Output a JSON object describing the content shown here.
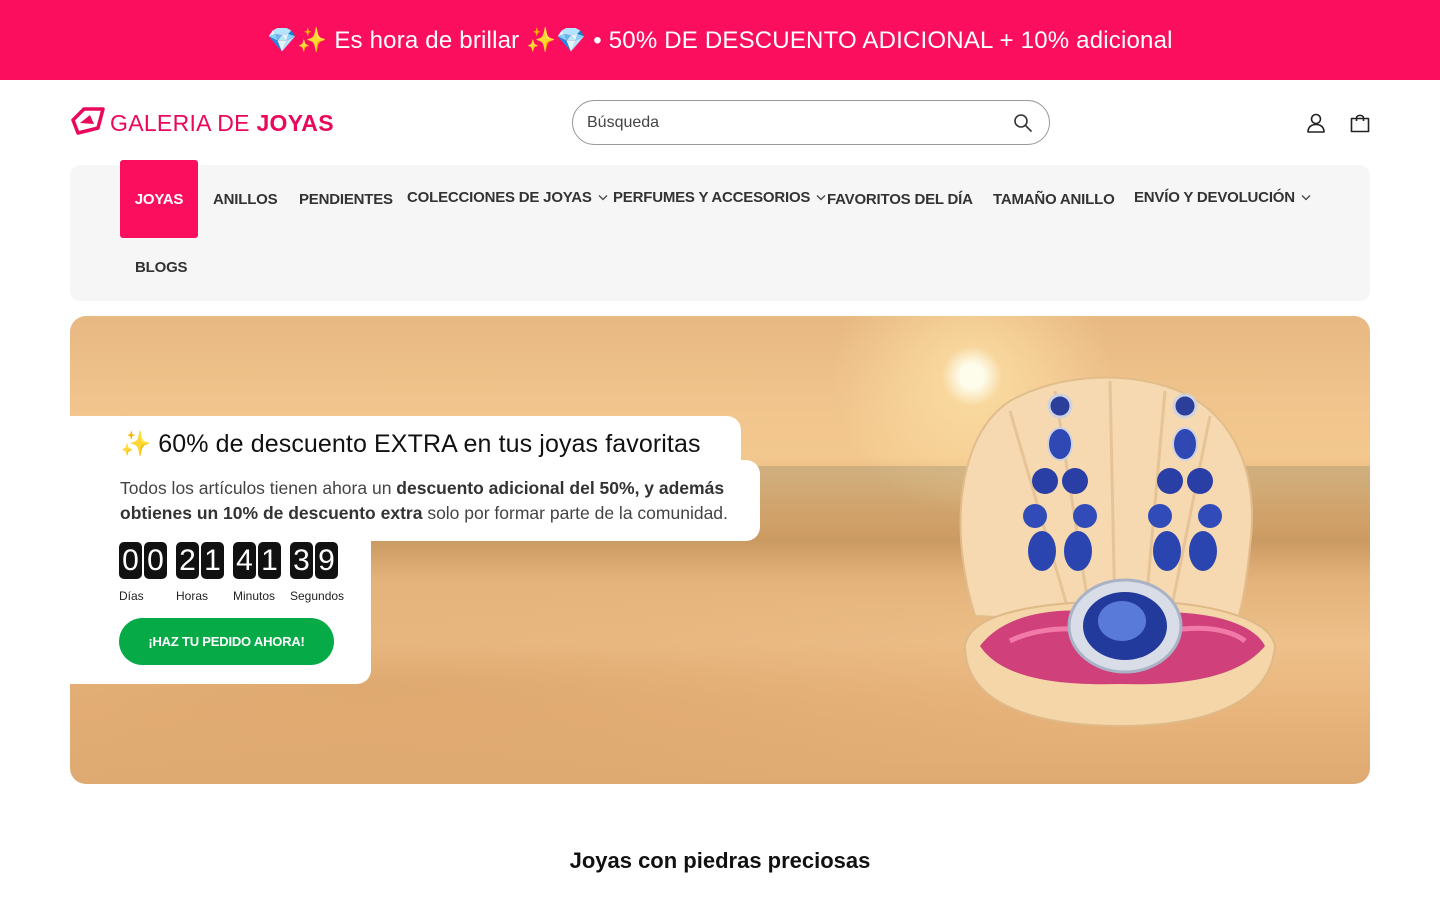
{
  "announcement": {
    "text": "💎✨ Es hora de brillar ✨💎 • 50% DE DESCUENTO ADICIONAL + 10% adicional"
  },
  "header": {
    "logo_text_light": "GALERIA DE ",
    "logo_text_bold": "JOYAS",
    "search_placeholder": "Búsqueda",
    "icons": [
      "account-icon",
      "cart-icon"
    ]
  },
  "nav": {
    "items": [
      {
        "label": "JOYAS",
        "active": true,
        "dropdown": false
      },
      {
        "label": "ANILLOS",
        "active": false,
        "dropdown": false
      },
      {
        "label": "PENDIENTES",
        "active": false,
        "dropdown": false
      },
      {
        "label": "COLECCIONES DE JOYAS",
        "active": false,
        "dropdown": true
      },
      {
        "label": "PERFUMES Y ACCESORIOS",
        "active": false,
        "dropdown": true
      },
      {
        "label": "FAVORITOS DEL DÍA",
        "active": false,
        "dropdown": false
      },
      {
        "label": "TAMAÑO ANILLO",
        "active": false,
        "dropdown": false
      },
      {
        "label": "ENVÍO Y DEVOLUCIÓN",
        "active": false,
        "dropdown": true
      },
      {
        "label": "BLOGS",
        "active": false,
        "dropdown": false
      }
    ]
  },
  "hero": {
    "title": "✨ 60% de descuento EXTRA en tus joyas favoritas",
    "desc_part1": "Todos los artículos tienen ahora un ",
    "desc_bold1": "descuento adicional del 50%, y además obtienes un 10% de descuento extra",
    "desc_part2": " solo por formar parte de la comunidad.",
    "countdown": [
      {
        "digits": [
          "0",
          "0"
        ],
        "label": "Días"
      },
      {
        "digits": [
          "2",
          "1"
        ],
        "label": "Horas"
      },
      {
        "digits": [
          "4",
          "1"
        ],
        "label": "Minutos"
      },
      {
        "digits": [
          "3",
          "9"
        ],
        "label": "Segundos"
      }
    ],
    "cta_label": "¡HAZ TU PEDIDO AHORA!"
  },
  "section": {
    "title": "Joyas con piedras preciosas"
  },
  "colors": {
    "brand_pink": "#fb0e5d",
    "cta_green": "#06aa47",
    "nav_bg": "#f6f6f6"
  }
}
